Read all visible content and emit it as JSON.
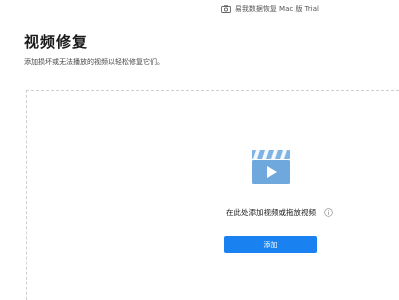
{
  "app": {
    "trial_label": "易我数据恢复 Mac 版 Trial"
  },
  "header": {
    "title": "视频修复",
    "description": "添加损坏或无法播放的视频以轻松修复它们。"
  },
  "drop_zone": {
    "hint": "在此处添加视频或拖放视频",
    "add_button_label": "添加"
  },
  "colors": {
    "accent": "#1a82f0",
    "icon_blue": "#6fa8dc"
  },
  "icons": [
    "camera-icon",
    "video-file-icon",
    "info-icon"
  ]
}
